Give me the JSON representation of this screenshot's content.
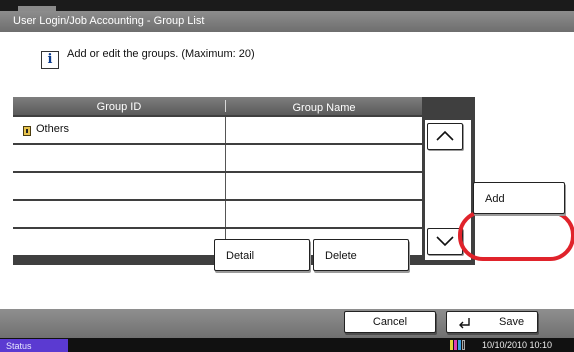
{
  "window": {
    "title": "User Login/Job Accounting - Group List"
  },
  "info": {
    "message": "Add or edit the groups. (Maximum: 20)",
    "icon": "info-icon"
  },
  "table": {
    "columns": [
      "Group ID",
      "Group Name"
    ],
    "rows": [
      {
        "group_id": "Others",
        "group_name": "",
        "icon": "folder-icon"
      },
      {
        "group_id": "",
        "group_name": ""
      },
      {
        "group_id": "",
        "group_name": ""
      },
      {
        "group_id": "",
        "group_name": ""
      },
      {
        "group_id": "",
        "group_name": ""
      }
    ]
  },
  "buttons": {
    "add": "Add",
    "detail": "Detail",
    "delete": "Delete",
    "cancel": "Cancel",
    "save": "Save"
  },
  "status": {
    "status_label": "Status",
    "datetime": "10/10/2010 10:10"
  },
  "colors": {
    "highlight": "#e0232b",
    "status_button": "#5b3ad1",
    "info_icon": "#0a3a8c"
  }
}
